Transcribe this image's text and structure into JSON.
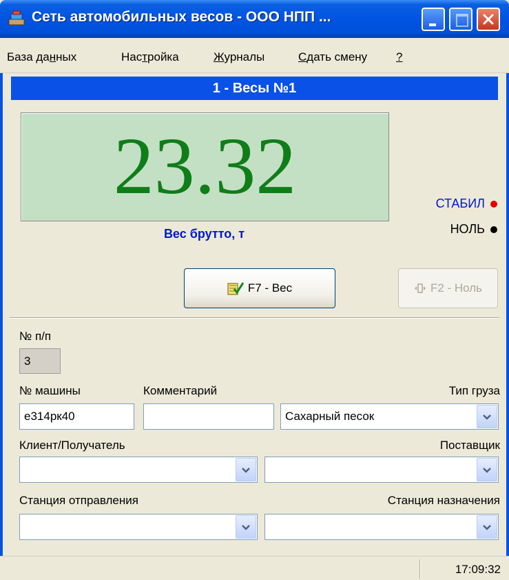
{
  "window": {
    "title": "Сеть автомобильных весов - ООО НПП ..."
  },
  "menu": [
    {
      "label": "База данных",
      "hotkey_index": 7
    },
    {
      "label": "Настройка",
      "hotkey_index": 3
    },
    {
      "label": "Журналы",
      "hotkey_index": 0
    },
    {
      "label": "Сдать смену",
      "hotkey_index": 0
    },
    {
      "label": "?",
      "hotkey_index": 0
    }
  ],
  "scale": {
    "header": "1 - Весы №1",
    "value": "23.32",
    "caption": "Вес брутто, т",
    "indicator_stable": "СТАБИЛ",
    "indicator_zero": "НОЛЬ",
    "stable_color": "#e00000",
    "zero_color": "#000000",
    "weigh_button": "F7 - Вес",
    "zero_button": "F2 - Ноль"
  },
  "form": {
    "seq_label": "№ п/п",
    "seq_value": "3",
    "truck_label": "№ машины",
    "truck_value": "е314рк40",
    "comment_label": "Комментарий",
    "comment_value": "",
    "cargo_label": "Тип груза",
    "cargo_value": "Сахарный песок",
    "client_label": "Клиент/Получатель",
    "client_value": "",
    "supplier_label": "Поставщик",
    "supplier_value": "",
    "from_station_label": "Станция отправления",
    "from_station_value": "",
    "to_station_label": "Станция назначения",
    "to_station_value": ""
  },
  "status": {
    "time": "17:09:32"
  },
  "colors": {
    "accent": "#0a51e8",
    "display_bg": "#c3e0c4",
    "display_text": "#0f7d18",
    "caption": "#0019cc"
  }
}
